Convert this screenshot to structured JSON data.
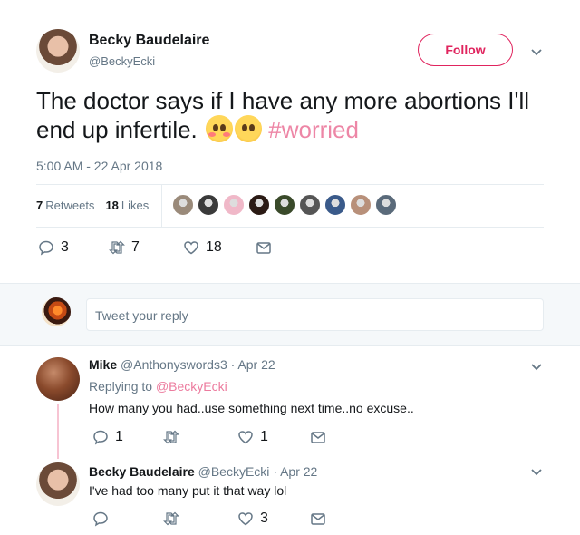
{
  "tweet": {
    "author_name": "Becky Baudelaire",
    "author_handle": "@BeckyEcki",
    "follow_label": "Follow",
    "text": "The doctor says if I have any more abortions I'll end up infertile.",
    "hashtag": "#worried",
    "timestamp": "5:00 AM - 22 Apr 2018",
    "retweets_count": "7",
    "retweets_label": "Retweets",
    "likes_count": "18",
    "likes_label": "Likes",
    "actions": {
      "reply_count": "3",
      "retweet_count": "7",
      "like_count": "18"
    },
    "emojis": [
      "flushed-face-emoji",
      "worried-face-emoji"
    ]
  },
  "likers": [
    "#9a8a7a",
    "#3a3a3a",
    "#f0b8c8",
    "#2a1a14",
    "#3a4a2a",
    "#555555",
    "#3a5a8a",
    "#b8907a",
    "#5a6a7a"
  ],
  "reply_box": {
    "placeholder": "Tweet your reply"
  },
  "replies": [
    {
      "name": "Mike",
      "handle": "@Anthonyswords3",
      "date": "· Apr 22",
      "replying_label": "Replying to",
      "replying_to": "@BeckyEcki",
      "text": "How many you had..use something next time..no excuse..",
      "reply_count": "1",
      "retweet_count": "",
      "like_count": "1"
    },
    {
      "name": "Becky Baudelaire",
      "handle": "@BeckyEcki",
      "date": "· Apr 22",
      "text": "I've had too many put it that way lol",
      "reply_count": "",
      "retweet_count": "",
      "like_count": "3"
    }
  ],
  "colors": {
    "accent": "#e0245e",
    "muted": "#657786",
    "text": "#14171a",
    "border": "#e6ecf0"
  }
}
